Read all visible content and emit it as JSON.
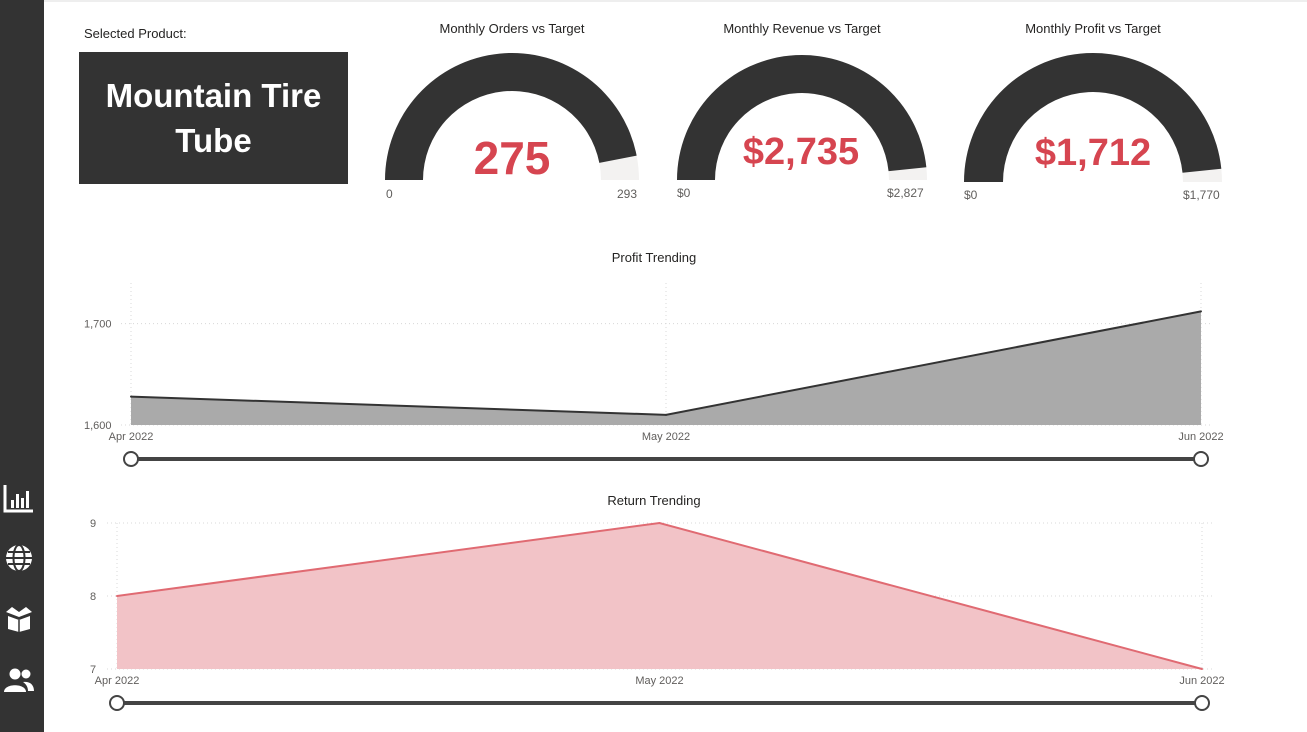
{
  "nav": {
    "items": [
      {
        "icon": "bar-chart-icon"
      },
      {
        "icon": "globe-icon"
      },
      {
        "icon": "product-box-icon"
      },
      {
        "icon": "customers-icon"
      }
    ]
  },
  "product": {
    "label": "Selected Product:",
    "name": "Mountain Tire Tube"
  },
  "gauges": [
    {
      "title": "Monthly Orders vs Target",
      "value": 275,
      "value_label": "275",
      "min": 0,
      "min_label": "0",
      "max": 293,
      "max_label": "293"
    },
    {
      "title": "Monthly Revenue vs Target",
      "value": 2735,
      "value_label": "$2,735",
      "min": 0,
      "min_label": "$0",
      "max": 2827,
      "max_label": "$2,827"
    },
    {
      "title": "Monthly Profit vs Target",
      "value": 1712,
      "value_label": "$1,712",
      "min": 0,
      "min_label": "$0",
      "max": 1770,
      "max_label": "$1,770"
    }
  ],
  "colors": {
    "sidebar": "#333333",
    "gauge_fill": "#333333",
    "gauge_track": "#f3f2f1",
    "accent_red": "#d64550",
    "profit_area": "#aaaaaa",
    "profit_line": "#333333",
    "return_area": "#f2c3c7",
    "return_line": "#e06a72"
  },
  "chart_data": [
    {
      "type": "area",
      "title": "Profit Trending",
      "x": [
        "Apr 2022",
        "May 2022",
        "Jun 2022"
      ],
      "values": [
        1628,
        1610,
        1712
      ],
      "ylim": [
        1600,
        1740
      ],
      "yticks": [
        1600,
        1700
      ],
      "ytick_labels": [
        "1,600",
        "1,700"
      ],
      "grid": true
    },
    {
      "type": "area",
      "title": "Return Trending",
      "x": [
        "Apr 2022",
        "May 2022",
        "Jun 2022"
      ],
      "values": [
        8,
        9,
        7
      ],
      "ylim": [
        7,
        9
      ],
      "yticks": [
        7,
        8,
        9
      ],
      "ytick_labels": [
        "7",
        "8",
        "9"
      ],
      "grid": true
    }
  ]
}
